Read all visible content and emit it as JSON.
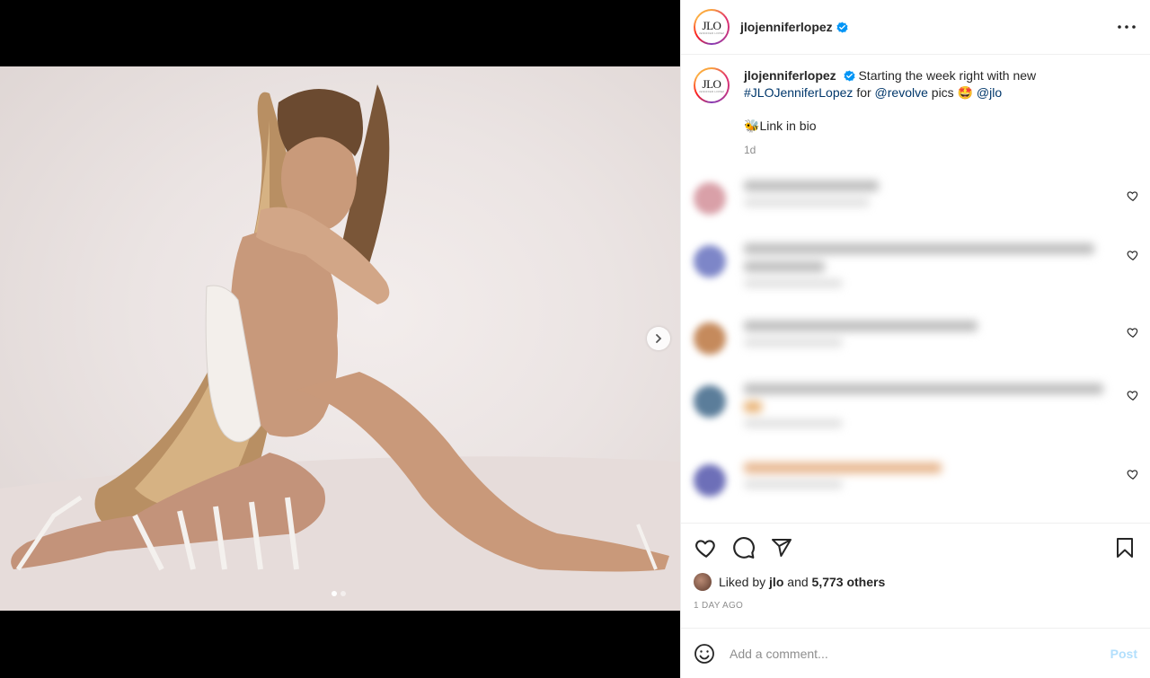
{
  "post": {
    "username": "jlojenniferlopez",
    "avatar_logo": "JLO",
    "avatar_logo_sub": "JENNIFER LOPEZ",
    "verified_icon": "verified-badge-icon",
    "more_icon": "more-options-icon",
    "caption": {
      "text_start": "Starting the week right with new",
      "hashtag": "#JLOJenniferLopez",
      "for_word": "for",
      "mention_brand": "@revolve",
      "pics_word": "pics",
      "emoji": "🤩",
      "mention_jlo": "@jlo",
      "line2_emoji": "🐝",
      "line2_text": "Link in bio",
      "time": "1d"
    },
    "likes": {
      "prefix": "Liked by",
      "user": "jlo",
      "joiner": "and",
      "others": "5,773 others"
    },
    "date": "1 DAY AGO",
    "comment_box": {
      "placeholder": "Add a comment...",
      "post_label": "Post",
      "emoji_icon": "emoji-smiley-icon"
    },
    "actions": [
      "like-heart-icon",
      "comment-bubble-icon",
      "share-paper-plane-icon",
      "save-bookmark-icon"
    ],
    "carousel": {
      "current": 1,
      "total": 2,
      "next_icon": "chevron-right-icon"
    }
  },
  "colors": {
    "link": "#00376b",
    "muted": "#8e8e8e",
    "post_disabled": "#b2dffc",
    "verified": "#0095f6"
  }
}
